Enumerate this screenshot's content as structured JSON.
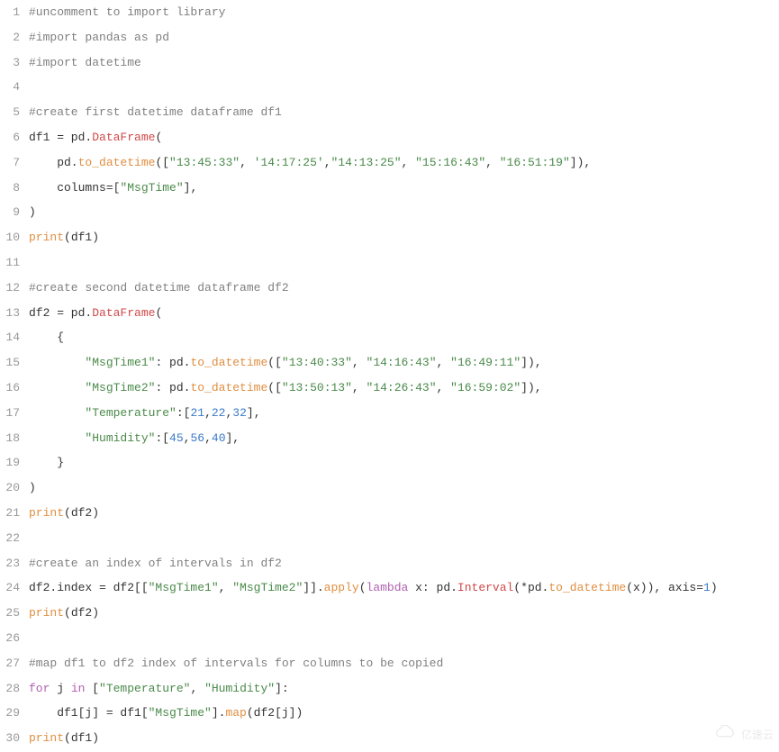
{
  "lines": [
    {
      "n": 1,
      "tokens": [
        [
          "c-comment",
          "#uncomment to import library"
        ]
      ]
    },
    {
      "n": 2,
      "tokens": [
        [
          "c-comment",
          "#import pandas as pd"
        ]
      ]
    },
    {
      "n": 3,
      "tokens": [
        [
          "c-comment",
          "#import datetime"
        ]
      ]
    },
    {
      "n": 4,
      "tokens": [
        [
          "",
          ""
        ]
      ]
    },
    {
      "n": 5,
      "tokens": [
        [
          "c-comment",
          "#create first datetime dataframe df1"
        ]
      ]
    },
    {
      "n": 6,
      "tokens": [
        [
          "",
          "df1 = pd."
        ],
        [
          "c-red",
          "DataFrame"
        ],
        [
          "",
          "("
        ]
      ]
    },
    {
      "n": 7,
      "tokens": [
        [
          "",
          "    pd."
        ],
        [
          "c-orange",
          "to_datetime"
        ],
        [
          "",
          "(["
        ],
        [
          "c-str",
          "\"13:45:33\""
        ],
        [
          "",
          ", "
        ],
        [
          "c-str",
          "'14:17:25'"
        ],
        [
          "",
          ","
        ],
        [
          "c-str",
          "\"14:13:25\""
        ],
        [
          "",
          ", "
        ],
        [
          "c-str",
          "\"15:16:43\""
        ],
        [
          "",
          ", "
        ],
        [
          "c-str",
          "\"16:51:19\""
        ],
        [
          "",
          "]),"
        ]
      ]
    },
    {
      "n": 8,
      "tokens": [
        [
          "",
          "    columns=["
        ],
        [
          "c-str",
          "\"MsgTime\""
        ],
        [
          "",
          "],"
        ]
      ]
    },
    {
      "n": 9,
      "tokens": [
        [
          "",
          ")"
        ]
      ]
    },
    {
      "n": 10,
      "tokens": [
        [
          "c-orange",
          "print"
        ],
        [
          "",
          "(df1)"
        ]
      ]
    },
    {
      "n": 11,
      "tokens": [
        [
          "",
          ""
        ]
      ]
    },
    {
      "n": 12,
      "tokens": [
        [
          "c-comment",
          "#create second datetime dataframe df2"
        ]
      ]
    },
    {
      "n": 13,
      "tokens": [
        [
          "",
          "df2 = pd."
        ],
        [
          "c-red",
          "DataFrame"
        ],
        [
          "",
          "("
        ]
      ]
    },
    {
      "n": 14,
      "tokens": [
        [
          "",
          "    {"
        ]
      ]
    },
    {
      "n": 15,
      "tokens": [
        [
          "",
          "        "
        ],
        [
          "c-str",
          "\"MsgTime1\""
        ],
        [
          "",
          ": pd."
        ],
        [
          "c-orange",
          "to_datetime"
        ],
        [
          "",
          "(["
        ],
        [
          "c-str",
          "\"13:40:33\""
        ],
        [
          "",
          ", "
        ],
        [
          "c-str",
          "\"14:16:43\""
        ],
        [
          "",
          ", "
        ],
        [
          "c-str",
          "\"16:49:11\""
        ],
        [
          "",
          "]),"
        ]
      ]
    },
    {
      "n": 16,
      "tokens": [
        [
          "",
          "        "
        ],
        [
          "c-str",
          "\"MsgTime2\""
        ],
        [
          "",
          ": pd."
        ],
        [
          "c-orange",
          "to_datetime"
        ],
        [
          "",
          "(["
        ],
        [
          "c-str",
          "\"13:50:13\""
        ],
        [
          "",
          ", "
        ],
        [
          "c-str",
          "\"14:26:43\""
        ],
        [
          "",
          ", "
        ],
        [
          "c-str",
          "\"16:59:02\""
        ],
        [
          "",
          "]),"
        ]
      ]
    },
    {
      "n": 17,
      "tokens": [
        [
          "",
          "        "
        ],
        [
          "c-str",
          "\"Temperature\""
        ],
        [
          "",
          ":["
        ],
        [
          "c-num",
          "21"
        ],
        [
          "",
          ","
        ],
        [
          "c-num",
          "22"
        ],
        [
          "",
          ","
        ],
        [
          "c-num",
          "32"
        ],
        [
          "",
          "],"
        ]
      ]
    },
    {
      "n": 18,
      "tokens": [
        [
          "",
          "        "
        ],
        [
          "c-str",
          "\"Humidity\""
        ],
        [
          "",
          ":["
        ],
        [
          "c-num",
          "45"
        ],
        [
          "",
          ","
        ],
        [
          "c-num",
          "56"
        ],
        [
          "",
          ","
        ],
        [
          "c-num",
          "40"
        ],
        [
          "",
          "],"
        ]
      ]
    },
    {
      "n": 19,
      "tokens": [
        [
          "",
          "    }"
        ]
      ]
    },
    {
      "n": 20,
      "tokens": [
        [
          "",
          ")"
        ]
      ]
    },
    {
      "n": 21,
      "tokens": [
        [
          "c-orange",
          "print"
        ],
        [
          "",
          "(df2)"
        ]
      ]
    },
    {
      "n": 22,
      "tokens": [
        [
          "",
          ""
        ]
      ]
    },
    {
      "n": 23,
      "tokens": [
        [
          "c-comment",
          "#create an index of intervals in df2"
        ]
      ]
    },
    {
      "n": 24,
      "tokens": [
        [
          "",
          "df2.index = df2[["
        ],
        [
          "c-str",
          "\"MsgTime1\""
        ],
        [
          "",
          ", "
        ],
        [
          "c-str",
          "\"MsgTime2\""
        ],
        [
          "",
          "]]."
        ],
        [
          "c-orange",
          "apply"
        ],
        [
          "",
          "("
        ],
        [
          "c-key",
          "lambda"
        ],
        [
          "",
          ""
        ],
        [
          "",
          " x: pd."
        ],
        [
          "c-red",
          "Interval"
        ],
        [
          "",
          "(*pd."
        ],
        [
          "c-orange",
          "to_datetime"
        ],
        [
          "",
          "(x)), axis="
        ],
        [
          "c-num",
          "1"
        ],
        [
          "",
          ")"
        ]
      ]
    },
    {
      "n": 25,
      "tokens": [
        [
          "c-orange",
          "print"
        ],
        [
          "",
          "(df2)"
        ]
      ]
    },
    {
      "n": 26,
      "tokens": [
        [
          "",
          ""
        ]
      ]
    },
    {
      "n": 27,
      "tokens": [
        [
          "c-comment",
          "#map df1 to df2 index of intervals for columns to be copied"
        ]
      ]
    },
    {
      "n": 28,
      "tokens": [
        [
          "c-key",
          "for"
        ],
        [
          "",
          " j "
        ],
        [
          "c-key",
          "in"
        ],
        [
          "",
          " ["
        ],
        [
          "c-str",
          "\"Temperature\""
        ],
        [
          "",
          ", "
        ],
        [
          "c-str",
          "\"Humidity\""
        ],
        [
          "",
          "]:"
        ]
      ]
    },
    {
      "n": 29,
      "tokens": [
        [
          "",
          "    df1[j] = df1["
        ],
        [
          "c-str",
          "\"MsgTime\""
        ],
        [
          "",
          "]."
        ],
        [
          "c-orange",
          "map"
        ],
        [
          "",
          "(df2[j])"
        ]
      ]
    },
    {
      "n": 30,
      "tokens": [
        [
          "c-orange",
          "print"
        ],
        [
          "",
          "(df1)"
        ]
      ]
    }
  ],
  "watermark": "亿速云"
}
